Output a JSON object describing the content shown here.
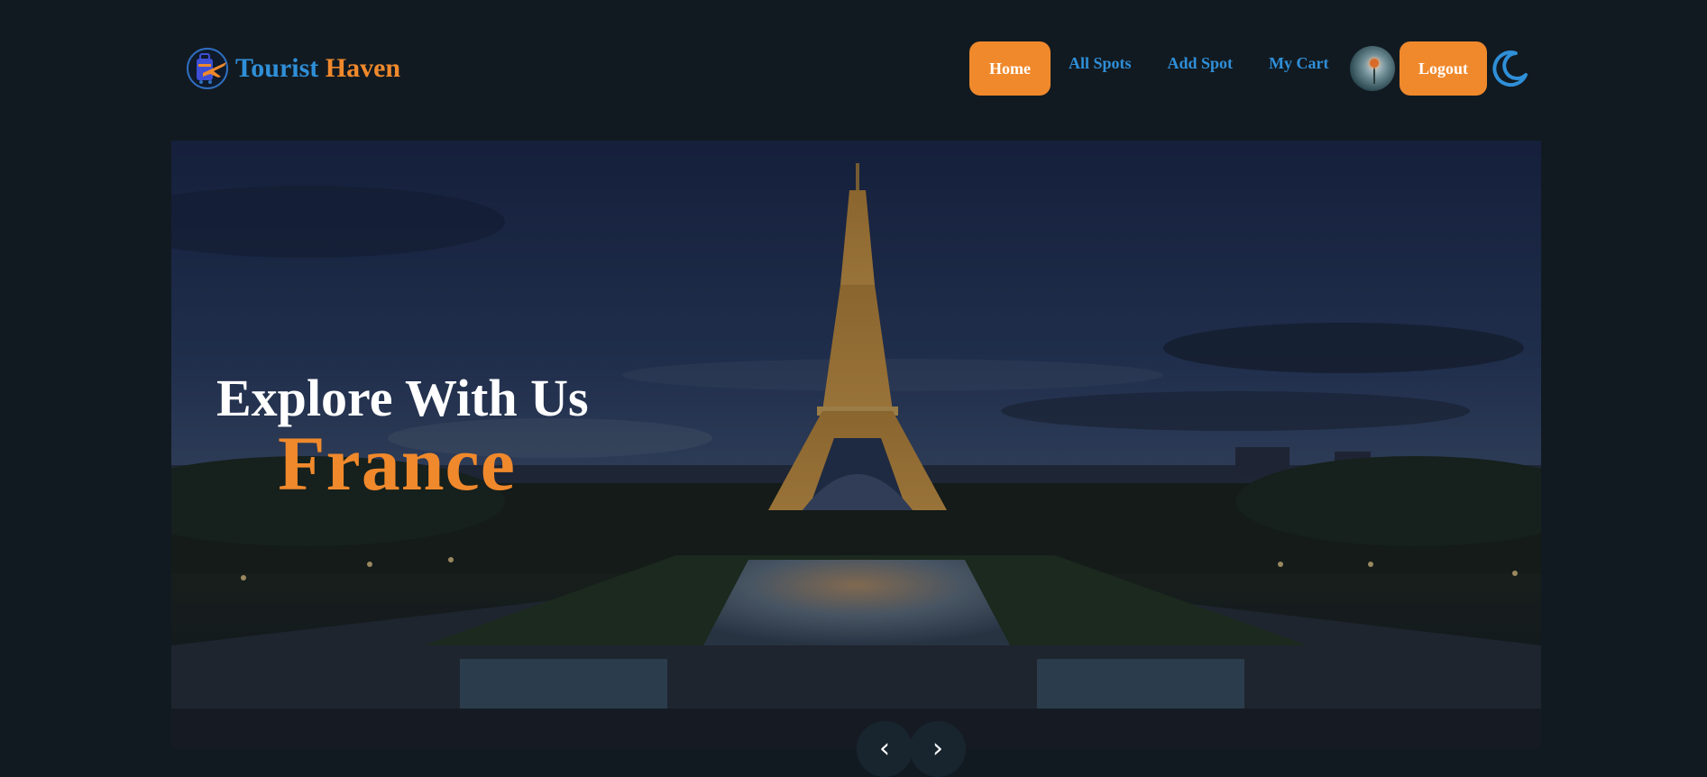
{
  "brand": {
    "name_first": "Tourist",
    "name_second": "Haven",
    "logo_icon": "travel-luggage-plane-icon"
  },
  "nav": {
    "items": [
      {
        "label": "Home",
        "active": true
      },
      {
        "label": "All Spots",
        "active": false
      },
      {
        "label": "Add Spot",
        "active": false
      },
      {
        "label": "My Cart",
        "active": false
      }
    ],
    "logout_label": "Logout",
    "theme_icon": "moon-icon",
    "avatar": "user-avatar"
  },
  "hero": {
    "title": "Explore With Us",
    "place": "France",
    "image": "eiffel-tower-night-scene",
    "prev_label": "‹",
    "next_label": "›"
  },
  "colors": {
    "background": "#121a21",
    "accent_orange": "#f0892c",
    "accent_blue": "#2f8fd8",
    "text_white": "#ffffff"
  }
}
